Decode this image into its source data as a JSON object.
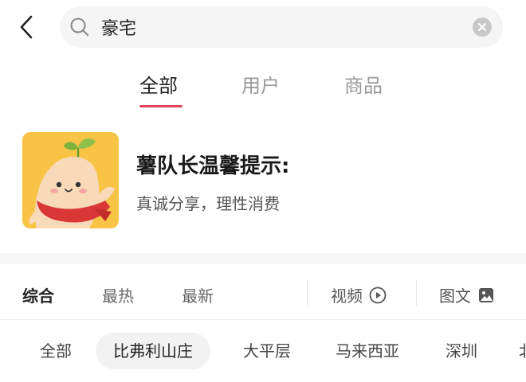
{
  "search": {
    "query": "豪宅"
  },
  "tabs": [
    {
      "label": "全部",
      "active": true
    },
    {
      "label": "用户",
      "active": false
    },
    {
      "label": "商品",
      "active": false
    }
  ],
  "notice": {
    "title": "薯队长温馨提示:",
    "subtitle": "真诚分享，理性消费"
  },
  "sort": {
    "items": [
      {
        "label": "综合",
        "active": true
      },
      {
        "label": "最热",
        "active": false
      },
      {
        "label": "最新",
        "active": false
      }
    ],
    "video_label": "视频",
    "image_text_label": "图文"
  },
  "chips": [
    {
      "label": "全部",
      "active": false
    },
    {
      "label": "比弗利山庄",
      "active": true
    },
    {
      "label": "大平层",
      "active": false
    },
    {
      "label": "马来西亚",
      "active": false
    },
    {
      "label": "深圳",
      "active": false
    },
    {
      "label": "北",
      "active": false
    }
  ],
  "colors": {
    "accent": "#e0425a",
    "mascot_bg": "#f9c445"
  }
}
